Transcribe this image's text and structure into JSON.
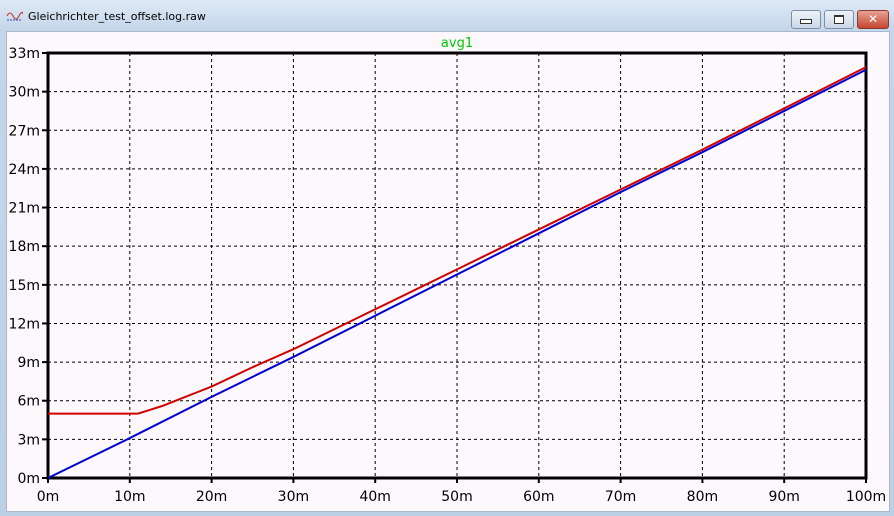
{
  "window": {
    "title": "Gleichrichter_test_offset.log.raw",
    "minimize": "minimize",
    "maximize": "maximize",
    "close": "close"
  },
  "chart_data": {
    "type": "line",
    "title": "avg1",
    "title_color": "#00c800",
    "xlabel": "",
    "ylabel": "",
    "xlim": [
      0,
      100
    ],
    "ylim": [
      0,
      33
    ],
    "x_ticks": [
      "0m",
      "10m",
      "20m",
      "30m",
      "40m",
      "50m",
      "60m",
      "70m",
      "80m",
      "90m",
      "100m"
    ],
    "y_ticks": [
      "0m",
      "3m",
      "6m",
      "9m",
      "12m",
      "15m",
      "18m",
      "21m",
      "24m",
      "27m",
      "30m",
      "33m"
    ],
    "grid": true,
    "series": [
      {
        "name": "blue",
        "color": "#0000d0",
        "x": [
          0,
          10,
          20,
          30,
          40,
          50,
          60,
          70,
          80,
          90,
          100
        ],
        "y": [
          0,
          3.1,
          6.3,
          9.4,
          12.6,
          15.8,
          19.0,
          22.2,
          25.3,
          28.5,
          31.7
        ]
      },
      {
        "name": "red",
        "color": "#d00000",
        "x": [
          0,
          5,
          10,
          11,
          12,
          14,
          16,
          18,
          20,
          25,
          30,
          40,
          50,
          60,
          70,
          80,
          90,
          100
        ],
        "y": [
          5,
          5,
          5,
          5,
          5.2,
          5.6,
          6.1,
          6.6,
          7.1,
          8.6,
          10.0,
          13.1,
          16.2,
          19.3,
          22.4,
          25.5,
          28.7,
          31.9
        ]
      }
    ]
  }
}
